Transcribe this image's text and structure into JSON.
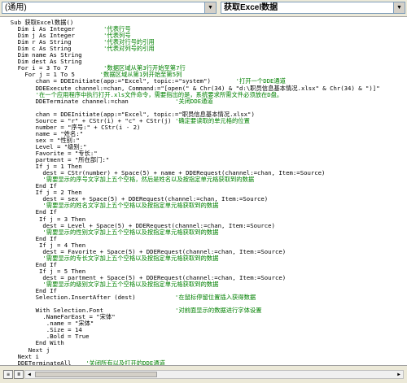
{
  "toolbar": {
    "object_combo": "(通用)",
    "proc_combo": "获取Excel数据",
    "dropdown_glyph": "▼"
  },
  "code_lines": [
    {
      "indent": 2,
      "parts": [
        {
          "t": "Sub 获取Excel数据()",
          "c": 0
        }
      ]
    },
    {
      "indent": 4,
      "parts": [
        {
          "t": "Dim i As Integer",
          "c": 0
        },
        {
          "t": "        '代表行号",
          "c": 1
        }
      ]
    },
    {
      "indent": 4,
      "parts": [
        {
          "t": "Dim j As Integer",
          "c": 0
        },
        {
          "t": "        '代表列号",
          "c": 1
        }
      ]
    },
    {
      "indent": 4,
      "parts": [
        {
          "t": "Dim r As String",
          "c": 0
        },
        {
          "t": "         '代表对行号的引用",
          "c": 1
        }
      ]
    },
    {
      "indent": 4,
      "parts": [
        {
          "t": "Dim c As String",
          "c": 0
        },
        {
          "t": "         '代表对列号的引用",
          "c": 1
        }
      ]
    },
    {
      "indent": 4,
      "parts": [
        {
          "t": "Dim name As String",
          "c": 0
        }
      ]
    },
    {
      "indent": 4,
      "parts": [
        {
          "t": "Dim dest As String",
          "c": 0
        }
      ]
    },
    {
      "indent": 4,
      "parts": [
        {
          "t": "For i = 3 To 7",
          "c": 0
        },
        {
          "t": "          '数据区域从第3行开始至第7行",
          "c": 1
        }
      ]
    },
    {
      "indent": 6,
      "parts": [
        {
          "t": "For j = 1 To 5",
          "c": 0
        },
        {
          "t": "       '数据区域从第1列开始至第5列",
          "c": 1
        }
      ]
    },
    {
      "indent": 9,
      "parts": [
        {
          "t": "chan = DDEInitiate(app:=\"Excel\", topic:=\"system\")",
          "c": 0
        },
        {
          "t": "       '打开一个DDE通道",
          "c": 1
        }
      ]
    },
    {
      "indent": 9,
      "parts": [
        {
          "t": "DDEExecute channel:=chan, Command:=\"[open(\" & Chr(34) & \"d:\\职员信息基本情况.xlsx\" & Chr(34) & \")]\"",
          "c": 0
        }
      ]
    },
    {
      "indent": 9,
      "parts": [
        {
          "t": "'在一个应用程序中执行打开.xls文件命令，需要指出的是，系统要求所需文件必须放在D盘。",
          "c": 1
        }
      ]
    },
    {
      "indent": 9,
      "parts": [
        {
          "t": "DDETerminate channel:=chan",
          "c": 0
        },
        {
          "t": "             '关闭DDE通道",
          "c": 1
        }
      ]
    },
    {
      "indent": 0,
      "parts": []
    },
    {
      "indent": 9,
      "parts": [
        {
          "t": "chan = DDEInitiate(app:=\"Excel\", topic:=\"职员信息基本情况.xlsx\")",
          "c": 0
        }
      ]
    },
    {
      "indent": 9,
      "parts": [
        {
          "t": "Source = \"r\" + CStr(i) + \"c\" + CStr(j)",
          "c": 0
        },
        {
          "t": " '确定要读取的单元格的位置",
          "c": 1
        }
      ]
    },
    {
      "indent": 9,
      "parts": [
        {
          "t": "number = \"序号:\" + CStr(i - 2)",
          "c": 0
        }
      ]
    },
    {
      "indent": 9,
      "parts": [
        {
          "t": "name = \"姓名:\"",
          "c": 0
        }
      ]
    },
    {
      "indent": 9,
      "parts": [
        {
          "t": "sex = \"性别:\"",
          "c": 0
        }
      ]
    },
    {
      "indent": 9,
      "parts": [
        {
          "t": "Level = \"级别:\"",
          "c": 0
        }
      ]
    },
    {
      "indent": 9,
      "parts": [
        {
          "t": "Favorite = \"专长:\"",
          "c": 0
        }
      ]
    },
    {
      "indent": 9,
      "parts": [
        {
          "t": "partment = \"所在部门:\"",
          "c": 0
        }
      ]
    },
    {
      "indent": 9,
      "parts": [
        {
          "t": "If j = 1 Then",
          "c": 0
        }
      ]
    },
    {
      "indent": 11,
      "parts": [
        {
          "t": "dest = CStr(number) + Space(5) + name + DDERequest(channel:=chan, Item:=Source)",
          "c": 0
        }
      ]
    },
    {
      "indent": 11,
      "parts": [
        {
          "t": "'需要显示的序号文字加上五个空格，然后是姓名以及按指定单元格获取到的数据",
          "c": 1
        }
      ]
    },
    {
      "indent": 9,
      "parts": [
        {
          "t": "End If",
          "c": 0
        }
      ]
    },
    {
      "indent": 9,
      "parts": [
        {
          "t": "If j = 2 Then",
          "c": 0
        }
      ]
    },
    {
      "indent": 11,
      "parts": [
        {
          "t": "dest = sex + Space(5) + DDERequest(channel:=chan, Item:=Source)",
          "c": 0
        }
      ]
    },
    {
      "indent": 11,
      "parts": [
        {
          "t": "'需要显示的姓名文字加上五个空格以及按指定单元格获取到的数据",
          "c": 1
        }
      ]
    },
    {
      "indent": 9,
      "parts": [
        {
          "t": "End If",
          "c": 0
        }
      ]
    },
    {
      "indent": 10,
      "parts": [
        {
          "t": "If j = 3 Then",
          "c": 0
        }
      ]
    },
    {
      "indent": 11,
      "parts": [
        {
          "t": "dest = Level + Space(5) + DDERequest(channel:=chan, Item:=Source)",
          "c": 0
        }
      ]
    },
    {
      "indent": 11,
      "parts": [
        {
          "t": "'需要显示的性别文字加上五个空格以及按指定单元格获取到的数据",
          "c": 1
        }
      ]
    },
    {
      "indent": 9,
      "parts": [
        {
          "t": "End If",
          "c": 0
        }
      ]
    },
    {
      "indent": 10,
      "parts": [
        {
          "t": "If j = 4 Then",
          "c": 0
        }
      ]
    },
    {
      "indent": 11,
      "parts": [
        {
          "t": "dest = Favorite + Space(5) + DDERequest(channel:=chan, Item:=Source)",
          "c": 0
        }
      ]
    },
    {
      "indent": 11,
      "parts": [
        {
          "t": "'需要显示的专长文字加上五个空格以及按指定单元格获取到的数据",
          "c": 1
        }
      ]
    },
    {
      "indent": 9,
      "parts": [
        {
          "t": "End If",
          "c": 0
        }
      ]
    },
    {
      "indent": 10,
      "parts": [
        {
          "t": "If j = 5 Then",
          "c": 0
        }
      ]
    },
    {
      "indent": 11,
      "parts": [
        {
          "t": "dest = partment + Space(5) + DDERequest(channel:=chan, Item:=Source)",
          "c": 0
        }
      ]
    },
    {
      "indent": 11,
      "parts": [
        {
          "t": "'需要显示的级别文字加上五个空格以及按指定单元格获取到的数据",
          "c": 1
        }
      ]
    },
    {
      "indent": 9,
      "parts": [
        {
          "t": "End If",
          "c": 0
        }
      ]
    },
    {
      "indent": 9,
      "parts": [
        {
          "t": "Selection.InsertAfter (dest)",
          "c": 0
        },
        {
          "t": "           '在鼠标停留位置插入获得数据",
          "c": 1
        }
      ]
    },
    {
      "indent": 0,
      "parts": []
    },
    {
      "indent": 9,
      "parts": [
        {
          "t": "With Selection.Font",
          "c": 0
        },
        {
          "t": "                    '对前面显示的数据进行字体设置",
          "c": 1
        }
      ]
    },
    {
      "indent": 11,
      "parts": [
        {
          "t": ".NameFarEast = \"宋体\"",
          "c": 0
        }
      ]
    },
    {
      "indent": 12,
      "parts": [
        {
          "t": ".name = \"宋体\"",
          "c": 0
        }
      ]
    },
    {
      "indent": 12,
      "parts": [
        {
          "t": ".Size = 14",
          "c": 0
        }
      ]
    },
    {
      "indent": 12,
      "parts": [
        {
          "t": ".Bold = True",
          "c": 0
        }
      ]
    },
    {
      "indent": 9,
      "parts": [
        {
          "t": "End With",
          "c": 0
        }
      ]
    },
    {
      "indent": 7,
      "parts": [
        {
          "t": "Next j",
          "c": 0
        }
      ]
    },
    {
      "indent": 4,
      "parts": [
        {
          "t": "Next i",
          "c": 0
        }
      ]
    },
    {
      "indent": 4,
      "parts": [
        {
          "t": "DDETerminateAll",
          "c": 0
        },
        {
          "t": "    '关闭所有以及打开的DDE通道",
          "c": 1
        }
      ]
    },
    {
      "indent": 2,
      "parts": [
        {
          "t": "End Sub",
          "c": 0
        }
      ]
    }
  ],
  "statusbar": {
    "procedure_view_glyph": "≡",
    "module_view_glyph": "≣",
    "scroll_left_glyph": "◀",
    "scroll_right_glyph": "▶"
  }
}
